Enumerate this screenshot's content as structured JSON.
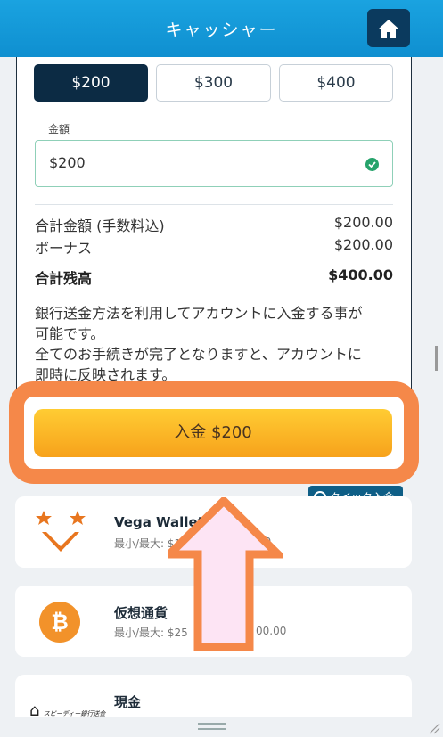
{
  "header": {
    "title": "キャッシャー",
    "home_icon": "home-icon"
  },
  "amount_options": [
    {
      "label": "$200",
      "selected": true
    },
    {
      "label": "$300",
      "selected": false
    },
    {
      "label": "$400",
      "selected": false
    }
  ],
  "amount_field": {
    "label": "金額",
    "value": "$200",
    "status_icon": "check-circle-icon"
  },
  "summary": {
    "total_label": "合計金額 (手数料込)",
    "total_value": "$200.00",
    "bonus_label": "ボーナス",
    "bonus_value": "$200.00",
    "balance_label": "合計残高",
    "balance_value": "$400.00"
  },
  "note": {
    "line1": "銀行送金方法を利用してアカウントに入金する事が",
    "line2": "可能です。",
    "line3": "全てのお手続きが完了となりますと、アカウントに",
    "line4": "即時に反映されます。"
  },
  "deposit_button": {
    "label": "入金 $200"
  },
  "quick_deposit": {
    "label": "クイック入金"
  },
  "payment_methods": [
    {
      "name": "Vega Wallet",
      "range": "最小/最大: $1",
      "range_tail": "00",
      "icon": "vega-wallet-icon"
    },
    {
      "name": "仮想通貨",
      "range": "最小/最大: $25",
      "range_tail": "00.00",
      "icon": "bitcoin-icon"
    },
    {
      "name": "現金",
      "range": "",
      "icon": "speedy-bank-icon",
      "logo_text": "スピーディー銀行送金"
    }
  ],
  "colors": {
    "header": "#1aa3e0",
    "accent_dark": "#0c2b44",
    "highlight": "#f58849",
    "deposit": "#f7a21b"
  }
}
